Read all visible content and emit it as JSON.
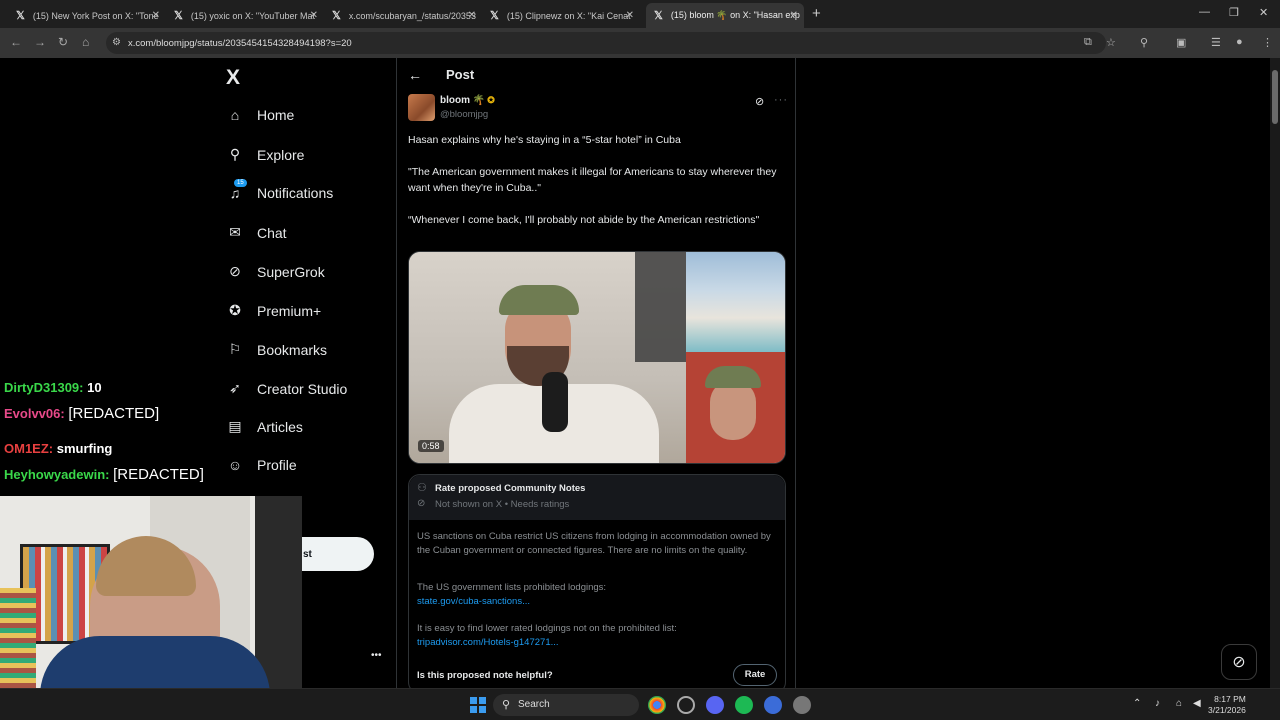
{
  "browser": {
    "tabs": [
      {
        "label": "(15) New York Post on X: \"Tone"
      },
      {
        "label": "(15) yoxic on X: \"YouTuber Mat"
      },
      {
        "label": "x.com/scubaryan_/status/20353"
      },
      {
        "label": "(15) Clipnewz on X: \"Kai Cenat"
      },
      {
        "label": "(15) bloom 🌴 on X: \"Hasan exp"
      }
    ],
    "url": "x.com/bloomjpg/status/2035454154328494198?s=20"
  },
  "sidebar": {
    "logo": "X",
    "notifications_badge": "15",
    "items": [
      {
        "label": "Home"
      },
      {
        "label": "Explore"
      },
      {
        "label": "Notifications"
      },
      {
        "label": "Chat"
      },
      {
        "label": "SuperGrok"
      },
      {
        "label": "Premium+"
      },
      {
        "label": "Bookmarks"
      },
      {
        "label": "Creator Studio"
      },
      {
        "label": "Articles"
      },
      {
        "label": "Profile"
      }
    ],
    "post_button_fragment": "st"
  },
  "post": {
    "header_title": "Post",
    "author_name": "bloom",
    "author_handle": "@bloomjpg",
    "text_1": "Hasan explains why he's staying in a “5-star hotel” in Cuba",
    "text_2": "\"The American government makes it illegal for Americans to stay wherever they want when they're in Cuba..\"",
    "text_3": "“Whenever I come back, I'll probably not abide by the American restrictions\"",
    "video_duration": "0:58"
  },
  "community_note": {
    "title": "Rate proposed Community Notes",
    "subtitle": "Not shown on X • Needs ratings",
    "body_1": "US sanctions on Cuba restrict US citizens from lodging in accommodation owned by the Cuban government or connected figures. There are no limits on the quality.",
    "body_2": "The US government lists prohibited lodgings:",
    "link_1": "state.gov/cuba-sanctions...",
    "body_3": "It is easy to find lower rated lodgings not on the prohibited list:",
    "link_2": "tripadvisor.com/Hotels-g147271...",
    "question": "Is this proposed note helpful?",
    "rate_label": "Rate"
  },
  "stream_chat": [
    {
      "user": "DirtyD31309:",
      "message": "10",
      "color": "#3ad84a"
    },
    {
      "user": "Evolvv06:",
      "message": "[REDACTED]",
      "color": "#e84a8a"
    },
    {
      "user": "OM1EZ:",
      "message": "smurfing",
      "color": "#e84040"
    },
    {
      "user": "Heyhowyadewin:",
      "message": "[REDACTED]",
      "color": "#3ad84a"
    }
  ],
  "taskbar": {
    "search_label": "Search",
    "time": "8:17 PM",
    "date": "3/21/2026"
  }
}
